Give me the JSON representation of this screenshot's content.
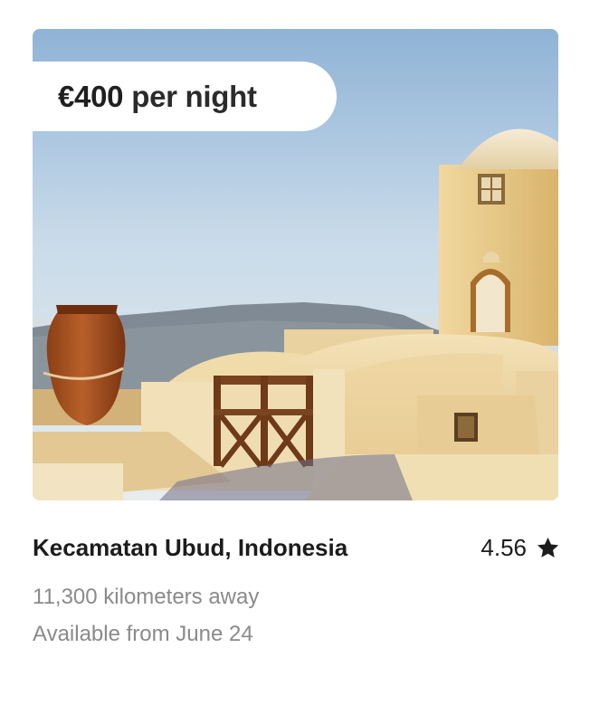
{
  "listing": {
    "price_amount": "€400",
    "price_suffix": "per night",
    "title": "Kecamatan Ubud, Indonesia",
    "rating": "4.56",
    "distance": "11,300 kilometers away",
    "availability": "Available from June 24"
  },
  "icons": {
    "rating": "star-icon"
  },
  "colors": {
    "text_primary": "#1c1c1c",
    "text_secondary": "#8a8a8a",
    "background": "#ffffff"
  }
}
